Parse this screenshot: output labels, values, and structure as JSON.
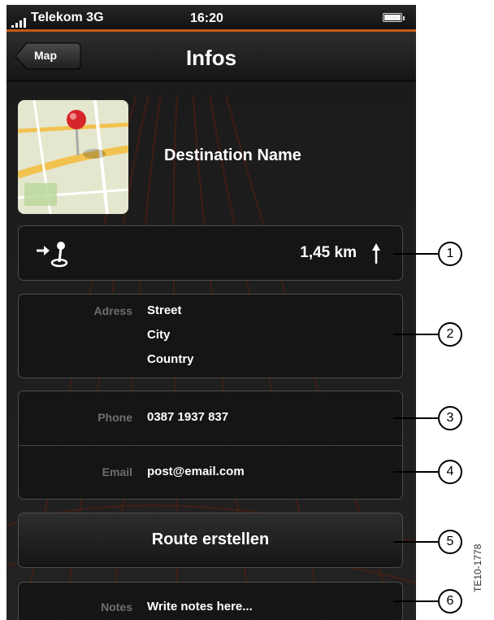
{
  "status_bar": {
    "carrier": "Telekom 3G",
    "time": "16:20"
  },
  "nav": {
    "back_label": "Map",
    "title": "Infos"
  },
  "destination": {
    "name": "Destination Name"
  },
  "distance": {
    "value": "1,45 km",
    "icon": "route-to-destination-icon",
    "direction_icon": "arrow-up-icon"
  },
  "address": {
    "label": "Adress",
    "lines": [
      "Street",
      "City",
      "Country"
    ]
  },
  "phone": {
    "label": "Phone",
    "value": "0387 1937 837"
  },
  "email": {
    "label": "Email",
    "value": "post@email.com"
  },
  "route_button": {
    "label": "Route erstellen"
  },
  "notes": {
    "label": "Notes",
    "placeholder": "Write notes here..."
  },
  "callouts": [
    "1",
    "2",
    "3",
    "4",
    "5",
    "6"
  ],
  "figure_id": "TE10-1778",
  "colors": {
    "accent": "#c25b19",
    "background": "#1c1c1c",
    "label": "#6e6e6e",
    "map_pin": "#d6262b"
  }
}
